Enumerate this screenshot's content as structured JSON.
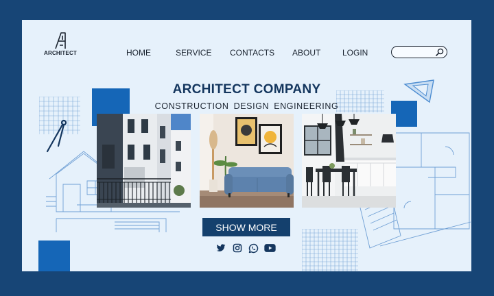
{
  "brand": {
    "logo_letter": "A",
    "name": "ARCHITECT"
  },
  "nav": {
    "home": "HOME",
    "service": "SERVICE",
    "contacts": "CONTACTS",
    "about": "ABOUT",
    "login": "LOGIN"
  },
  "search": {
    "placeholder": "",
    "icon": "search-icon"
  },
  "hero": {
    "title": "ARCHITECT COMPANY",
    "subtitle": "CONSTRUCTION  DESIGN  ENGINEERING",
    "button": "SHOW MORE"
  },
  "gallery": [
    {
      "name": "house-exterior-photo"
    },
    {
      "name": "living-room-photo"
    },
    {
      "name": "kitchen-dining-photo"
    }
  ],
  "social": [
    "twitter-icon",
    "instagram-icon",
    "whatsapp-icon",
    "youtube-icon"
  ],
  "colors": {
    "frame": "#174576",
    "page": "#e6f1fb",
    "accent_square": "#1566b7",
    "button": "#14406d",
    "title": "#14365e",
    "blueprint": "#7ea9d8"
  }
}
